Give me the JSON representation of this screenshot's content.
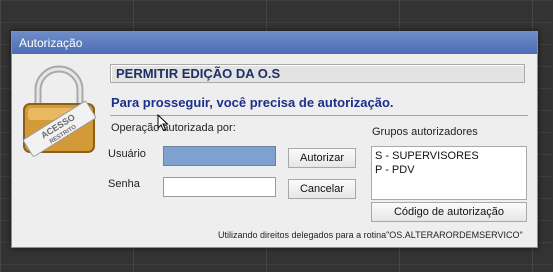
{
  "dialog": {
    "title": "Autorização",
    "lock_badge_text": "ACESSO RESTRITO",
    "header": "PERMITIR EDIÇÃO DA O.S",
    "subtitle": "Para prosseguir, você precisa de autorização.",
    "operation_label": "Operação autorizada por:",
    "user_label": "Usuário",
    "password_label": "Senha",
    "user_value": "",
    "password_value": "",
    "authorize_button": "Autorizar",
    "cancel_button": "Cancelar",
    "groups_label": "Grupos autorizadores",
    "groups": [
      "S - SUPERVISORES",
      "P - PDV"
    ],
    "auth_code_button": "Código de autorização",
    "footer_note": "Utilizando direitos delegados para a rotina\"OS.ALTERARORDEMSERVICO\""
  },
  "colors": {
    "titlebar": "#5a7bc0",
    "header_text": "#1f2f66",
    "subtitle_text": "#1c2f8a",
    "focused_input": "#7fa1cf"
  }
}
